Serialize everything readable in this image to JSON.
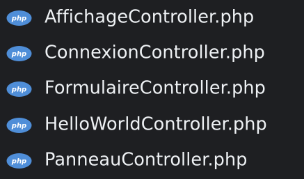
{
  "explorer": {
    "files": [
      {
        "name": "AffichageController.php",
        "icon": "php-file-icon",
        "icon_text": "php"
      },
      {
        "name": "ConnexionController.php",
        "icon": "php-file-icon",
        "icon_text": "php"
      },
      {
        "name": "FormulaireController.php",
        "icon": "php-file-icon",
        "icon_text": "php"
      },
      {
        "name": "HelloWorldController.php",
        "icon": "php-file-icon",
        "icon_text": "php"
      },
      {
        "name": "PanneauController.php",
        "icon": "php-file-icon",
        "icon_text": "php"
      }
    ]
  },
  "colors": {
    "background": "#1e1f22",
    "text": "#eef1f4",
    "php_icon_fill": "#4f8ed8",
    "php_icon_text": "#ffffff"
  }
}
